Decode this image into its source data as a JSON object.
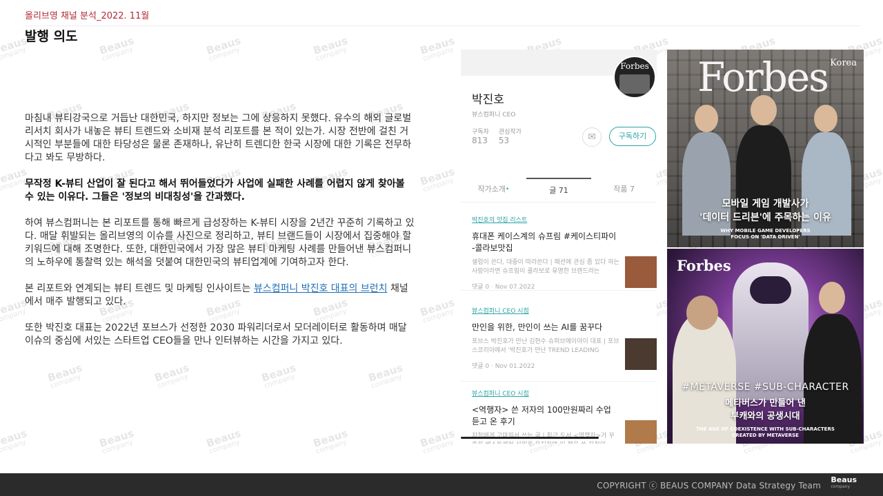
{
  "header": {
    "subtitle": "올리브영 채널 분석_2022. 11월",
    "title": "발행 의도"
  },
  "body": {
    "p1": "마침내 뷰티강국으로 거듭난 대한민국, 하지만 정보는 그에 상응하지 못했다. 유수의 해외 글로벌 리서치 회사가 내놓은 뷰티 트렌드와 소비재 분석 리포트를 본 적이 있는가. 시장 전반에 걸친 거시적인 부분들에 대한 타당성은 물론 존재하나, 유난히 트렌디한 한국 시장에 대한 기록은 전무하다고 봐도 무방하다.",
    "p2": "무작정 K-뷰티 산업이 잘 된다고 해서 뛰어들었다가 사업에 실패한 사례를 어렵지 않게 찾아볼 수 있는 이유다. 그들은 '정보의 비대칭성'을 간과했다.",
    "p3": "하여 뷰스컴퍼니는 본 리포트를 통해 빠르게 급성장하는 K-뷰티 시장을 2년간 꾸준히 기록하고 있다. 매달 휘발되는 올리브영의 이슈를 사진으로 정리하고, 뷰티 브랜드들이 시장에서 집중해야 할 키워드에 대해 조명한다. 또한, 대한민국에서 가장 많은 뷰티 마케팅 사례를 만들어낸 뷰스컴퍼니의 노하우에 통찰력 있는 해석을 덧붙여 대한민국의 뷰티업계에 기여하고자 한다.",
    "p4_before": "본 리포트와 연계되는 뷰티 트렌드 및 마케팅 인사이트는 ",
    "p4_link": "뷰스컴퍼니 박진호 대표의 브런치",
    "p4_after": " 채널에서 매주 발행되고 있다.",
    "p5": "또한 박진호 대표는 2022년 포브스가 선정한 2030 파워리더로서 모더레이터로 활동하며 매달 이슈의 중심에 서있는 스타트업 CEO들을 만나 인터뷰하는 시간을 가지고 있다."
  },
  "blog": {
    "avatar_text": "Forbes",
    "author_name": "박진호",
    "author_role": "뷰스컴퍼니 CEO",
    "stats": [
      {
        "label": "구독자",
        "value": "813"
      },
      {
        "label": "관심작가",
        "value": "53"
      }
    ],
    "mail_icon": "✉",
    "subscribe_label": "구독하기",
    "tabs": [
      {
        "label": "작가소개",
        "dot": "•"
      },
      {
        "label": "글 71"
      },
      {
        "label": "작품 7"
      }
    ],
    "posts": [
      {
        "category": "박진호의 맛집 리스트",
        "title": "휴대폰 케이스계의 슈프림 #케이스티파이 -콜라보맛집",
        "excerpt": "셀럽이 쓴다, 대중이 따라쓴다 | 패션에 관심 좀 있다 하는 사람이라면 슈프림이 콜라보로 유명한 브랜드라는",
        "meta": "댓글 0 · Nov 07.2022",
        "thumb_color": "#9a5a3c"
      },
      {
        "category": "뷰스컴퍼니 CEO 시점",
        "title": "만인을 위한, 만인이 쓰는 AI를 꿈꾸다",
        "excerpt": "포브스 박진호가 만난 김현수 슈퍼브에이아이 대표 | 포브스코리아에서 '박진호가 만난 TREND LEADING",
        "meta": "댓글 0 · Nov 01.2022",
        "thumb_color": "#4a3a30"
      },
      {
        "category": "뷰스컴퍼니 CEO 시점",
        "title": "<역행자> 쓴 저자의 100만원짜리 수업 듣고 온 후기",
        "excerpt": "자청에게 고마워서 쓰는 글 | 최근 도서 <역행자>가 꾸준히 베스트셀러 상위를 유지하며 이 책을 쓴 자청의",
        "meta": "",
        "thumb_color": "#b07a4a"
      }
    ]
  },
  "covers": {
    "cover1": {
      "brand": "Forbes",
      "edition": "Korea",
      "headline_line1": "모바일 게임 개발사가",
      "headline_line2": "'데이터 드리븐'에 주목하는 이유",
      "sub_line1": "WHY MOBILE GAME DEVELOPERS",
      "sub_line2": "FOCUS ON 'DATA DRIVEN'"
    },
    "cover2": {
      "brand": "Forbes",
      "tags": "#METAVERSE #SUB-CHARACTER",
      "headline_line1": "메타버스가 만들어 낸",
      "headline_line2": "부캐와의 공생시대",
      "sub_line1": "THE AGE OF COEXISTENCE WITH SUB-CHARACTERS",
      "sub_line2": "CREATED BY METAVERSE"
    }
  },
  "watermark": {
    "line1": "Beaus",
    "line2": "company"
  },
  "footer": {
    "copyright": "COPYRIGHT ⓒ BEAUS COMPANY Data Strategy Team",
    "logo_line1": "Beaus",
    "logo_line2": "company"
  },
  "colors": {
    "accent": "#b22a35",
    "teal": "#2aa3a3",
    "link": "#1f6fb5",
    "footer_bg": "#2b2b2b"
  }
}
